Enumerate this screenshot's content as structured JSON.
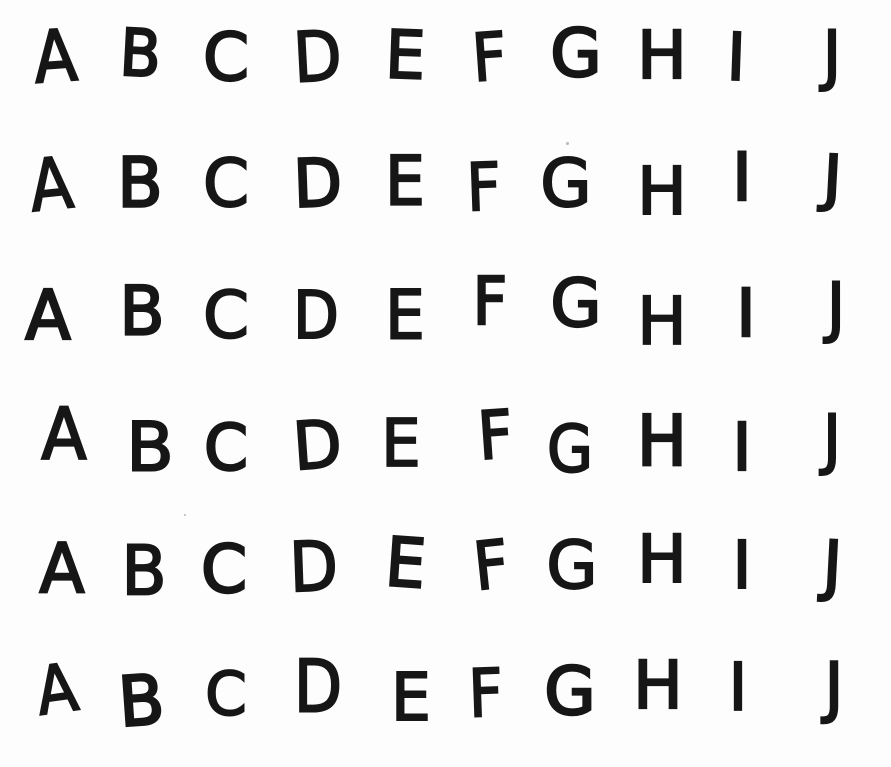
{
  "sheet": {
    "rows": [
      [
        "A",
        "B",
        "C",
        "D",
        "E",
        "F",
        "G",
        "H",
        "I",
        "J"
      ],
      [
        "A",
        "B",
        "C",
        "D",
        "E",
        "F",
        "G",
        "H",
        "I",
        "J"
      ],
      [
        "A",
        "B",
        "C",
        "D",
        "E",
        "F",
        "G",
        "H",
        "I",
        "J"
      ],
      [
        "A",
        "B",
        "C",
        "D",
        "E",
        "F",
        "G",
        "H",
        "I",
        "J"
      ],
      [
        "A",
        "B",
        "C",
        "D",
        "E",
        "F",
        "G",
        "H",
        "I",
        "J"
      ],
      [
        "A",
        "B",
        "C",
        "D",
        "E",
        "F",
        "G",
        "H",
        "I",
        "J"
      ]
    ],
    "ink_color": "#161616",
    "paper_color": "#fdfdfd"
  }
}
